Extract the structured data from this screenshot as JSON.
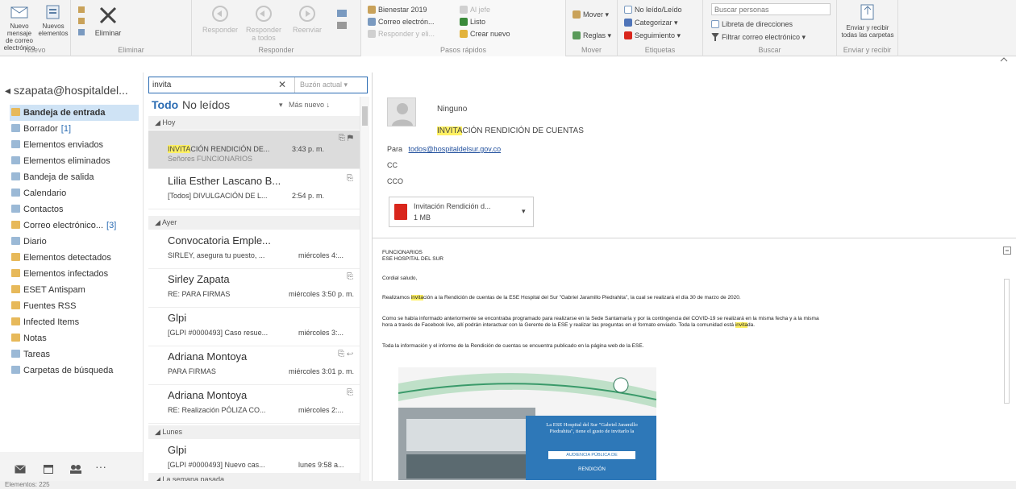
{
  "ribbon": {
    "new_email": "Nuevo mensaje de correo electrónico",
    "new_items": "Nuevos elementos",
    "group_new": "Nuevo",
    "delete": "Eliminar",
    "group_delete": "Eliminar",
    "reply": "Responder",
    "reply_all": "Responder a todos",
    "forward": "Reenviar",
    "group_respond": "Responder",
    "quick_steps": [
      "Bienestar 2019",
      "Al jefe",
      "Correo electrón...",
      "Listo",
      "Responder y eli...",
      "Crear nuevo"
    ],
    "group_quick_steps": "Pasos rápidos",
    "move": "Mover",
    "rules": "Reglas",
    "group_move": "Mover",
    "unread_read": "No leído/Leído",
    "categorize": "Categorizar",
    "follow_up": "Seguimiento",
    "group_tags": "Etiquetas",
    "search_people_placeholder": "Buscar personas",
    "address_book": "Libreta de direcciones",
    "filter_email": "Filtrar correo electrónico",
    "group_find": "Buscar",
    "send_receive": "Enviar y recibir todas las carpetas",
    "group_send_receive": "Enviar y recibir"
  },
  "folders": {
    "account": "szapata@hospitaldel...",
    "items": [
      {
        "label": "Bandeja de entrada",
        "count": "",
        "color": "#e7b95a"
      },
      {
        "label": "Borrador",
        "count": "[1]",
        "color": "#9bb9d6"
      },
      {
        "label": "Elementos enviados",
        "count": "",
        "color": "#9bb9d6"
      },
      {
        "label": "Elementos eliminados",
        "count": "",
        "color": "#9bb9d6"
      },
      {
        "label": "Bandeja de salida",
        "count": "",
        "color": "#9bb9d6"
      },
      {
        "label": "Calendario",
        "count": "",
        "color": "#9bb9d6"
      },
      {
        "label": "Contactos",
        "count": "",
        "color": "#9bb9d6"
      },
      {
        "label": "Correo electrónico...",
        "count": "[3]",
        "color": "#e7b95a"
      },
      {
        "label": "Diario",
        "count": "",
        "color": "#9bb9d6"
      },
      {
        "label": "Elementos detectados",
        "count": "",
        "color": "#e7b95a"
      },
      {
        "label": "Elementos infectados",
        "count": "",
        "color": "#e7b95a"
      },
      {
        "label": "ESET Antispam",
        "count": "",
        "color": "#e7b95a"
      },
      {
        "label": "Fuentes RSS",
        "count": "",
        "color": "#e7b95a"
      },
      {
        "label": "Infected Items",
        "count": "",
        "color": "#e7b95a"
      },
      {
        "label": "Notas",
        "count": "",
        "color": "#e7b95a"
      },
      {
        "label": "Tareas",
        "count": "",
        "color": "#9bb9d6"
      },
      {
        "label": "Carpetas de búsqueda",
        "count": "",
        "color": "#9bb9d6"
      }
    ]
  },
  "search": {
    "query": "invita",
    "scope": "Buzón actual"
  },
  "msglist": {
    "tab_all": "Todo",
    "tab_unread": "No leídos",
    "sort": "Más nuevo ↓",
    "groups": [
      "Hoy",
      "Ayer",
      "Lunes",
      "La semana pasada"
    ],
    "mails": [
      {
        "from": "",
        "subject_hl": "INVITA",
        "subject_rest": "CIÓN RENDICIÓN DE...",
        "time": "3:43 p. m.",
        "preview": "Señores FUNCIONARIOS"
      },
      {
        "from": "Lilia Esther Lascano B...",
        "subject_hl": "",
        "subject_rest": "[Todos] DIVULGACIÓN DE L...",
        "time": "2:54 p. m.",
        "preview": ""
      },
      {
        "from": "Convocatoria Emple...",
        "subject_hl": "",
        "subject_rest": "SIRLEY, asegura tu puesto, ...",
        "time": "miércoles 4:...",
        "preview": ""
      },
      {
        "from": "Sirley Zapata",
        "subject_hl": "",
        "subject_rest": "RE: PARA FIRMAS",
        "time": "miércoles 3:50 p. m.",
        "preview": ""
      },
      {
        "from": "Glpi",
        "subject_hl": "",
        "subject_rest": "[GLPI #0000493] Caso resue...",
        "time": "miércoles 3:...",
        "preview": ""
      },
      {
        "from": "Adriana Montoya",
        "subject_hl": "",
        "subject_rest": "PARA FIRMAS",
        "time": "miércoles 3:01 p. m.",
        "preview": ""
      },
      {
        "from": "Adriana Montoya",
        "subject_hl": "",
        "subject_rest": "RE: Realización PÓLIZA CO...",
        "time": "miércoles 2:...",
        "preview": ""
      },
      {
        "from": "Glpi",
        "subject_hl": "",
        "subject_rest": "[GLPI #0000493] Nuevo cas...",
        "time": "lunes 9:58 a...",
        "preview": ""
      }
    ]
  },
  "reading": {
    "sender": "Ninguno",
    "subject_hl": "INVITA",
    "subject_rest": "CIÓN RENDICIÓN DE CUENTAS",
    "to_label": "Para",
    "to": "todos@hospitaldelsur.gov.co",
    "cc_label": "CC",
    "bcc_label": "CCO",
    "attachment_name": "Invitación Rendición d...",
    "attachment_size": "1 MB",
    "body": {
      "line1": "FUNCIONARIOS",
      "line2": "ESE HOSPITAL DEL SUR",
      "greeting": "Cordial saludo,",
      "p1_a": "Realizamos ",
      "p1_hl": "invita",
      "p1_b": "ción a la Rendición de cuentas de la ESE Hospital del Sur \"Gabriel Jaramillo Piedrahita\", la cual se realizará el día 30 de marzo de 2020.",
      "p2_a": "Como se había informado anteriormente se encontraba programado para realizarse en la Sede Santamaría y por la contingencia del COVID-19 se realizará en la misma fecha y a la misma",
      "p2_b": "hora a través de Facebook live, allí podrán interactuar con la Gerente de la ESE y realizar las preguntas en el formato enviado. Toda la comunidad está ",
      "p2_hl": "invita",
      "p2_c": "da.",
      "p3": "Toda la información y el informe de la Rendición de cuentas se encuentra publicado en la página web de la ESE.",
      "banner_text": "La ESE Hospital del Sur \"Gabriel Jaramillo Piedrahita\", tiene el gusto de invitarlo la",
      "banner_btn": "AUDIENCIA PÚBLICA DE",
      "banner_sub": "RENDICIÓN"
    }
  },
  "status": {
    "text": "Elementos: 225"
  }
}
